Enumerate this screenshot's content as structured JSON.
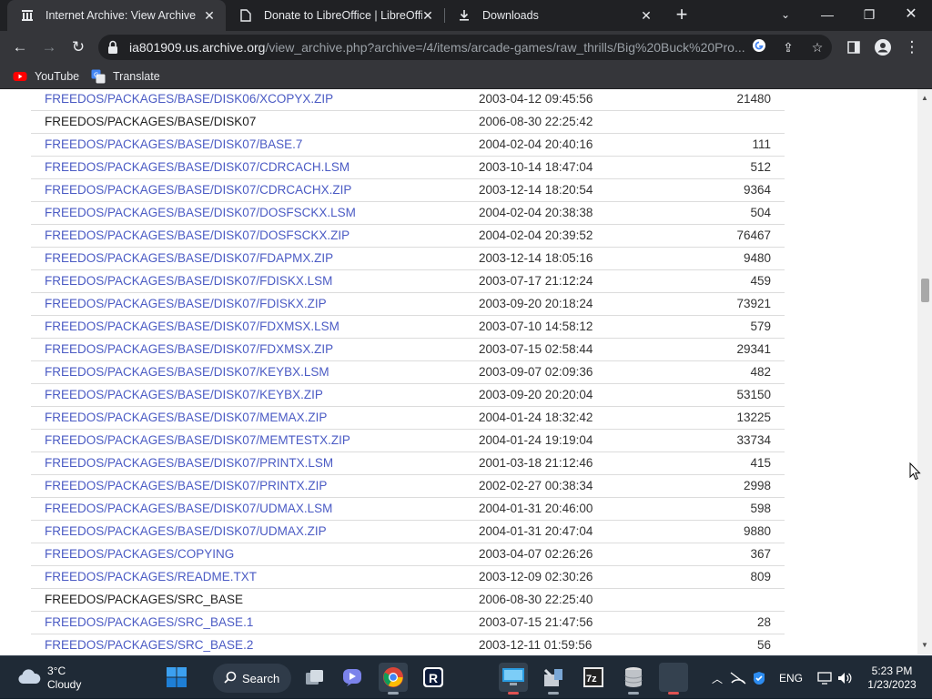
{
  "browser": {
    "tabs": [
      {
        "title": "Internet Archive: View Archive",
        "active": true
      },
      {
        "title": "Donate to LibreOffice | LibreOffic",
        "active": false
      },
      {
        "title": "Downloads",
        "active": false
      }
    ],
    "url_host": "ia801909.us.archive.org",
    "url_path": "/view_archive.php?archive=/4/items/arcade-games/raw_thrills/Big%20Buck%20Pro...",
    "bookmarks": [
      {
        "label": "YouTube"
      },
      {
        "label": "Translate"
      }
    ]
  },
  "listing": {
    "rows": [
      {
        "name": "FREEDOS/PACKAGES/BASE/DISK06/XCOPYX.ZIP",
        "date": "2003-04-12 09:45:56",
        "size": "21480",
        "link": true
      },
      {
        "name": "FREEDOS/PACKAGES/BASE/DISK07",
        "date": "2006-08-30 22:25:42",
        "size": "",
        "link": false
      },
      {
        "name": "FREEDOS/PACKAGES/BASE/DISK07/BASE.7",
        "date": "2004-02-04 20:40:16",
        "size": "111",
        "link": true
      },
      {
        "name": "FREEDOS/PACKAGES/BASE/DISK07/CDRCACH.LSM",
        "date": "2003-10-14 18:47:04",
        "size": "512",
        "link": true
      },
      {
        "name": "FREEDOS/PACKAGES/BASE/DISK07/CDRCACHX.ZIP",
        "date": "2003-12-14 18:20:54",
        "size": "9364",
        "link": true
      },
      {
        "name": "FREEDOS/PACKAGES/BASE/DISK07/DOSFSCKX.LSM",
        "date": "2004-02-04 20:38:38",
        "size": "504",
        "link": true
      },
      {
        "name": "FREEDOS/PACKAGES/BASE/DISK07/DOSFSCKX.ZIP",
        "date": "2004-02-04 20:39:52",
        "size": "76467",
        "link": true
      },
      {
        "name": "FREEDOS/PACKAGES/BASE/DISK07/FDAPMX.ZIP",
        "date": "2003-12-14 18:05:16",
        "size": "9480",
        "link": true
      },
      {
        "name": "FREEDOS/PACKAGES/BASE/DISK07/FDISKX.LSM",
        "date": "2003-07-17 21:12:24",
        "size": "459",
        "link": true
      },
      {
        "name": "FREEDOS/PACKAGES/BASE/DISK07/FDISKX.ZIP",
        "date": "2003-09-20 20:18:24",
        "size": "73921",
        "link": true
      },
      {
        "name": "FREEDOS/PACKAGES/BASE/DISK07/FDXMSX.LSM",
        "date": "2003-07-10 14:58:12",
        "size": "579",
        "link": true
      },
      {
        "name": "FREEDOS/PACKAGES/BASE/DISK07/FDXMSX.ZIP",
        "date": "2003-07-15 02:58:44",
        "size": "29341",
        "link": true
      },
      {
        "name": "FREEDOS/PACKAGES/BASE/DISK07/KEYBX.LSM",
        "date": "2003-09-07 02:09:36",
        "size": "482",
        "link": true
      },
      {
        "name": "FREEDOS/PACKAGES/BASE/DISK07/KEYBX.ZIP",
        "date": "2003-09-20 20:20:04",
        "size": "53150",
        "link": true
      },
      {
        "name": "FREEDOS/PACKAGES/BASE/DISK07/MEMAX.ZIP",
        "date": "2004-01-24 18:32:42",
        "size": "13225",
        "link": true
      },
      {
        "name": "FREEDOS/PACKAGES/BASE/DISK07/MEMTESTX.ZIP",
        "date": "2004-01-24 19:19:04",
        "size": "33734",
        "link": true
      },
      {
        "name": "FREEDOS/PACKAGES/BASE/DISK07/PRINTX.LSM",
        "date": "2001-03-18 21:12:46",
        "size": "415",
        "link": true
      },
      {
        "name": "FREEDOS/PACKAGES/BASE/DISK07/PRINTX.ZIP",
        "date": "2002-02-27 00:38:34",
        "size": "2998",
        "link": true
      },
      {
        "name": "FREEDOS/PACKAGES/BASE/DISK07/UDMAX.LSM",
        "date": "2004-01-31 20:46:00",
        "size": "598",
        "link": true
      },
      {
        "name": "FREEDOS/PACKAGES/BASE/DISK07/UDMAX.ZIP",
        "date": "2004-01-31 20:47:04",
        "size": "9880",
        "link": true
      },
      {
        "name": "FREEDOS/PACKAGES/COPYING",
        "date": "2003-04-07 02:26:26",
        "size": "367",
        "link": true
      },
      {
        "name": "FREEDOS/PACKAGES/README.TXT",
        "date": "2003-12-09 02:30:26",
        "size": "809",
        "link": true
      },
      {
        "name": "FREEDOS/PACKAGES/SRC_BASE",
        "date": "2006-08-30 22:25:40",
        "size": "",
        "link": false
      },
      {
        "name": "FREEDOS/PACKAGES/SRC_BASE.1",
        "date": "2003-07-15 21:47:56",
        "size": "28",
        "link": true
      },
      {
        "name": "FREEDOS/PACKAGES/SRC_BASE.2",
        "date": "2003-12-11 01:59:56",
        "size": "56",
        "link": true
      }
    ]
  },
  "taskbar": {
    "weather_temp": "3°C",
    "weather_desc": "Cloudy",
    "search_label": "Search",
    "lang": "ENG",
    "time": "5:23 PM",
    "date": "1/23/2023"
  },
  "icons": {
    "tab1": "archive-icon",
    "tab2": "page-icon",
    "tab3": "download-icon"
  },
  "colors": {
    "link": "#4b5bc4",
    "chrome_dark": "#202124",
    "chrome_toolbar": "#35363a",
    "taskbar": "#1f2a36"
  }
}
